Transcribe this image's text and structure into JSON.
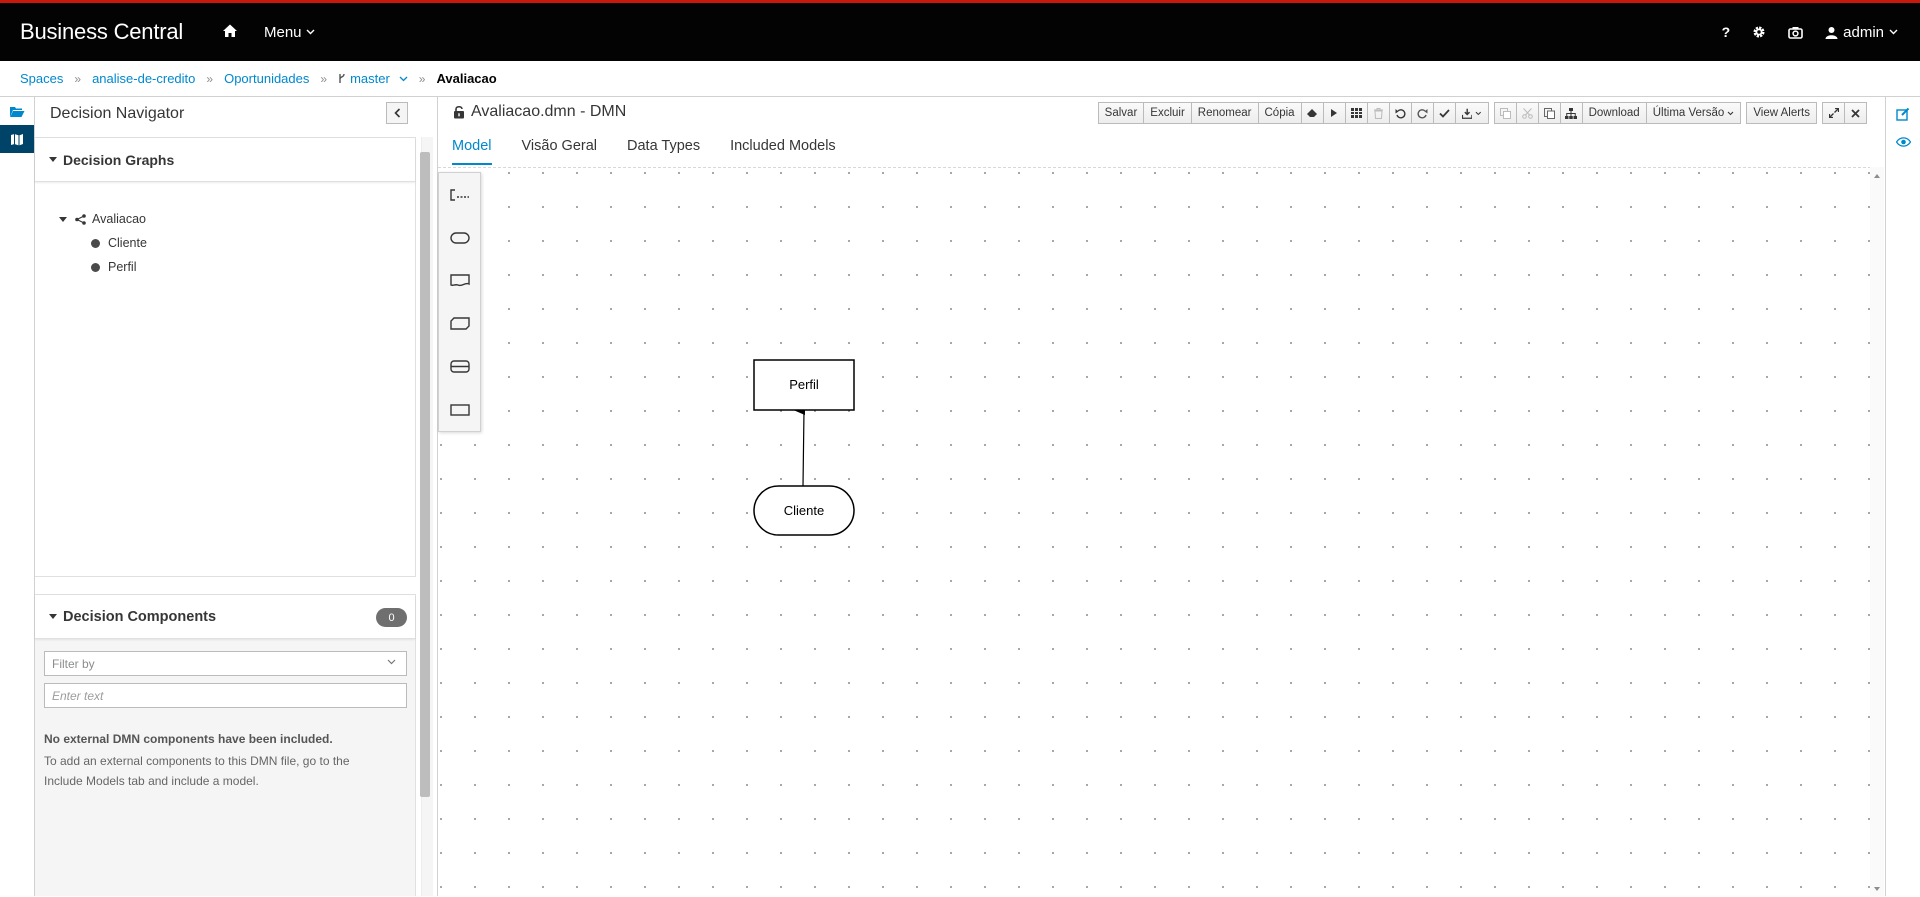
{
  "app": {
    "brand": "Business Central",
    "menu_label": "Menu",
    "user": "admin",
    "colors": {
      "topbar": "#030303",
      "accent": "#0088ce",
      "top_border": "#c9190b"
    }
  },
  "top_icons": [
    "home-icon",
    "help-icon",
    "gear-icon",
    "camera-icon",
    "user-icon"
  ],
  "breadcrumb": {
    "items": [
      "Spaces",
      "analise-de-credito",
      "Oportunidades"
    ],
    "branch": "master",
    "current": "Avaliacao"
  },
  "navigator": {
    "title": "Decision Navigator",
    "graphs": {
      "title": "Decision Graphs",
      "root": "Avaliacao",
      "children": [
        "Cliente",
        "Perfil"
      ]
    },
    "components": {
      "title": "Decision Components",
      "count": "0",
      "filter_placeholder": "Filter by",
      "search_placeholder": "Enter text",
      "empty_title": "No external DMN components have been included.",
      "empty_text": "To add an external components to this DMN file, go to the Include Models tab and include a model."
    }
  },
  "editor": {
    "title": "Avaliacao.dmn - DMN",
    "toolbar": {
      "save": "Salvar",
      "delete": "Excluir",
      "rename": "Renomear",
      "copy": "Cópia",
      "download": "Download",
      "latest_version": "Última Versão",
      "view_alerts": "View Alerts"
    },
    "tabs": [
      "Model",
      "Visão Geral",
      "Data Types",
      "Included Models"
    ],
    "active_tab": "Model",
    "palette": [
      "text-annotation-icon",
      "input-data-icon",
      "knowledge-source-icon",
      "bkm-icon",
      "decision-service-icon",
      "decision-icon"
    ],
    "nodes": {
      "decision": "Perfil",
      "input": "Cliente"
    }
  }
}
